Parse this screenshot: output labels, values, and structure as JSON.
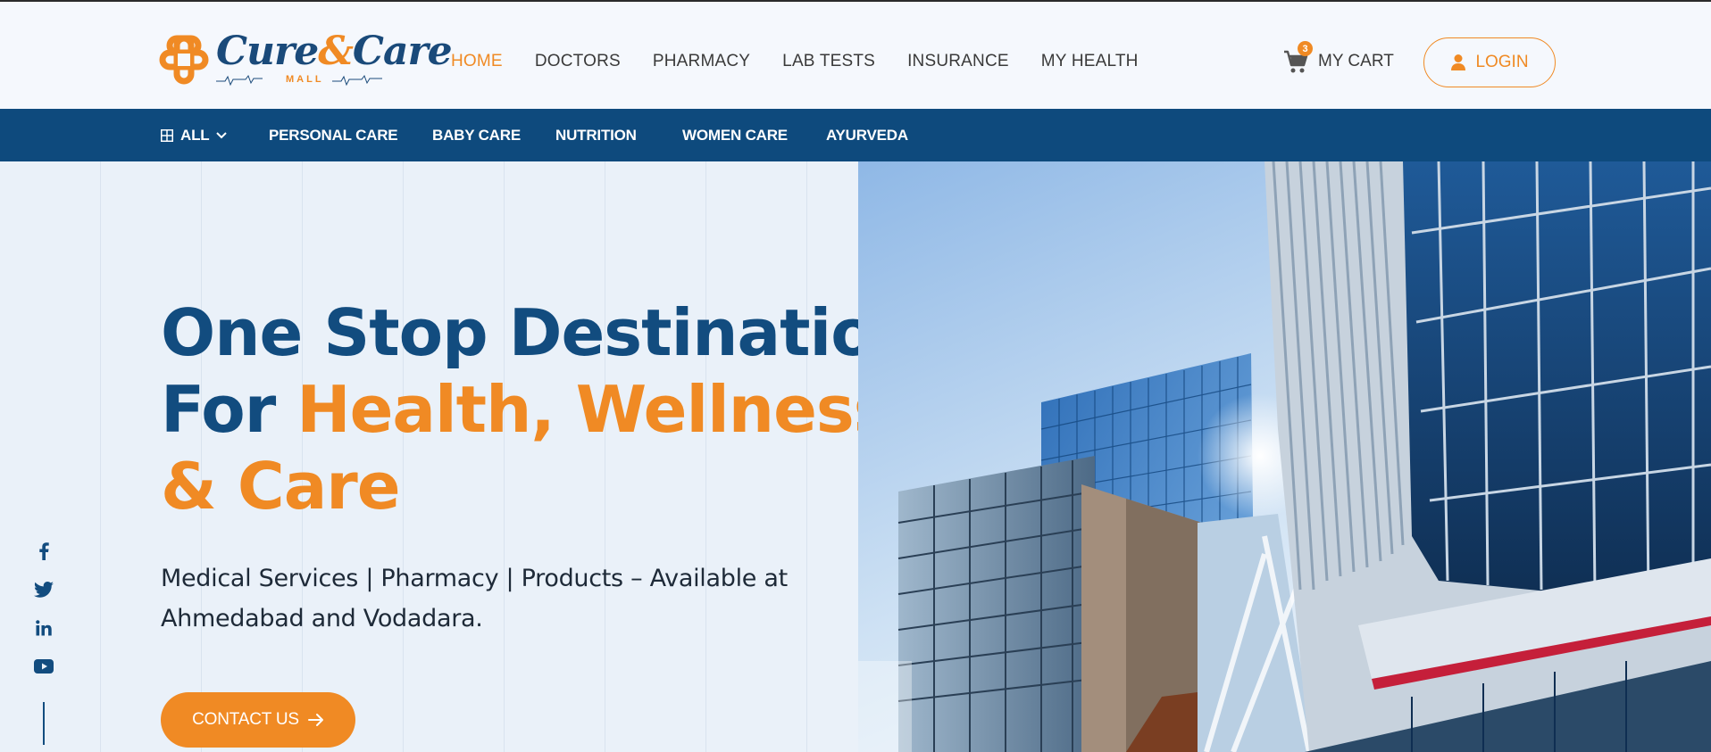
{
  "brand": {
    "name_part1": "Cure",
    "name_amp": "&",
    "name_part2": "Care",
    "sub": "MALL"
  },
  "nav": {
    "items": [
      {
        "label": "HOME",
        "active": true
      },
      {
        "label": "DOCTORS",
        "active": false
      },
      {
        "label": "PHARMACY",
        "active": false
      },
      {
        "label": "LAB TESTS",
        "active": false
      },
      {
        "label": "INSURANCE",
        "active": false
      },
      {
        "label": "MY HEALTH",
        "active": false
      }
    ]
  },
  "cart": {
    "count": "3",
    "label": "MY CART",
    "icon": "cart-icon"
  },
  "login": {
    "label": "LOGIN",
    "icon": "user-icon"
  },
  "categories": {
    "all_label": "ALL",
    "items": [
      "PERSONAL CARE",
      "BABY CARE",
      "NUTRITION",
      "WOMEN CARE",
      "AYURVEDA"
    ]
  },
  "hero": {
    "line1": "One Stop Destination",
    "line2_prefix": "For ",
    "line2_highlight": "Health, Wellness",
    "line3": "& Care",
    "sub_line1": "Medical Services | Pharmacy | Products – Available at",
    "sub_line2": "Ahmedabad and Vodadara.",
    "cta_label": "CONTACT US"
  },
  "social": [
    "facebook-icon",
    "twitter-icon",
    "linkedin-icon",
    "youtube-icon"
  ],
  "colors": {
    "primary": "#124c7f",
    "accent": "#f08a24",
    "catbar": "#0e4a7d",
    "hero_bg": "#eaf1f9"
  }
}
